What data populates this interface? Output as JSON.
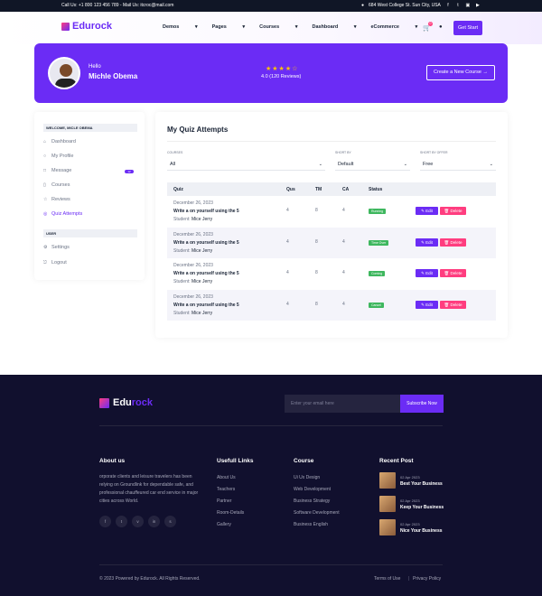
{
  "topbar": {
    "contact": "Call Us: +1 800 123 456 789 - Mail Us: itcroc@mail.com",
    "address": "684 West College St. Sun City, USA"
  },
  "header": {
    "logo": "Edurock",
    "nav": [
      "Demos",
      "Pages",
      "Courses",
      "Dashboard",
      "eCommerce"
    ],
    "cart_count": "0",
    "cta": "Get Start"
  },
  "banner": {
    "greeting": "Hello",
    "name": "Michle Obema",
    "rating_stars": 4,
    "reviews": "4.0 (120 Reviews)",
    "button": "Create a New Course"
  },
  "sidebar": {
    "welcome": "WELCOME, MICLE OBEMA",
    "items": [
      {
        "label": "Dashboard",
        "icon": "home-icon"
      },
      {
        "label": "My Profile",
        "icon": "user-icon"
      },
      {
        "label": "Message",
        "icon": "message-icon",
        "badge": "12"
      },
      {
        "label": "Courses",
        "icon": "bookmark-icon"
      },
      {
        "label": "Reviews",
        "icon": "star-icon"
      },
      {
        "label": "Quiz Attempts",
        "icon": "help-circle-icon"
      }
    ],
    "user_section": "USER",
    "user_items": [
      {
        "label": "Settings",
        "icon": "settings-icon"
      },
      {
        "label": "Logout",
        "icon": "logout-icon"
      }
    ]
  },
  "main": {
    "title": "My Quiz Attempts",
    "filters": [
      {
        "label": "COURSES",
        "value": "All"
      },
      {
        "label": "SHORT BY",
        "value": "Default"
      },
      {
        "label": "SHORT BY OFFER",
        "value": "Free"
      }
    ],
    "columns": [
      "Quiz",
      "Qus",
      "TM",
      "CA",
      "Status"
    ],
    "rows": [
      {
        "date": "December 26, 2023",
        "title": "Write a on yourself using the 5",
        "student_label": "Student:",
        "student": "Mice Jerry",
        "qus": "4",
        "tm": "8",
        "ca": "4",
        "status": "Running",
        "status_color": "#3eb75e"
      },
      {
        "date": "December 26, 2023",
        "title": "Write a on yourself using the 5",
        "student_label": "Student:",
        "student": "Mice Jerry",
        "qus": "4",
        "tm": "8",
        "ca": "4",
        "status": "Time Over",
        "status_color": "#3eb75e"
      },
      {
        "date": "December 26, 2023",
        "title": "Write a on yourself using the 5",
        "student_label": "Student:",
        "student": "Mice Jerry",
        "qus": "4",
        "tm": "8",
        "ca": "4",
        "status": "Coming",
        "status_color": "#3eb75e"
      },
      {
        "date": "December 26, 2023",
        "title": "Write a on yourself using the 5",
        "student_label": "Student:",
        "student": "Mice Jerry",
        "qus": "4",
        "tm": "8",
        "ca": "4",
        "status": "Cancel",
        "status_color": "#3eb75e"
      }
    ],
    "edit_label": "Edit",
    "delete_label": "Delete"
  },
  "footer": {
    "logo_main": "Edu",
    "logo_accent": "rock",
    "newsletter_placeholder": "Enter your email here",
    "subscribe": "Subscribe Now",
    "about_title": "About us",
    "about_text": "orporate clients and leisure travelers has been relying on Groundlink for dependable safe, and professional chauffeured car end service in major cities across World.",
    "social_icons": [
      "facebook-icon",
      "twitter-icon",
      "vimeo-icon",
      "linkedin-icon",
      "skype-icon"
    ],
    "links_title": "Usefull Links",
    "links": [
      "About Us",
      "Teachers",
      "Partner",
      "Room-Details",
      "Gallery"
    ],
    "course_title": "Course",
    "courses": [
      "Ui Ux Design",
      "Web Development",
      "Business Strategy",
      "Software Development",
      "Business English"
    ],
    "recent_title": "Recent Post",
    "posts": [
      {
        "date": "02 Apr 2023",
        "title": "Best Your Business"
      },
      {
        "date": "02 Apr 2023",
        "title": "Keep Your Business"
      },
      {
        "date": "02 Apr 2023",
        "title": "Nice Your Business"
      }
    ],
    "copyright": "© 2023 Powered by Edurock. All Rights Reserved.",
    "terms": "Terms of Use",
    "privacy": "Privacy Policy"
  }
}
